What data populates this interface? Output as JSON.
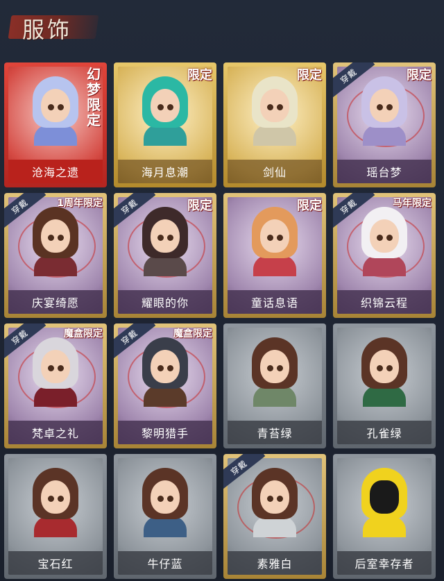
{
  "header": {
    "title": "服饰"
  },
  "cards": [
    {
      "name": "沧海之遗",
      "style": "red",
      "tag": "幻梦限定",
      "tag_vertical": true,
      "wearing": false,
      "hair": "#b7c4ef",
      "outfit": "#7d8fd8"
    },
    {
      "name": "海月息潮",
      "style": "gold",
      "tag": "限定",
      "wearing": false,
      "hair": "#2bb8a4",
      "outfit": "#2f9f9a"
    },
    {
      "name": "剑仙",
      "style": "gold",
      "tag": "限定",
      "wearing": false,
      "hair": "#e9e4c8",
      "outfit": "#cfc6a8"
    },
    {
      "name": "瑶台梦",
      "style": "purple",
      "tag": "限定",
      "wearing": true,
      "wear_label": "穿戴",
      "hair": "#c9c1e6",
      "outfit": "#9d8fc8"
    },
    {
      "name": "庆宴绮愿",
      "style": "purple",
      "tag": "1周年限定",
      "wearing": true,
      "wear_label": "穿戴",
      "hair": "#5a3323",
      "outfit": "#7a2c32"
    },
    {
      "name": "耀眼的你",
      "style": "purple",
      "tag": "限定",
      "wearing": true,
      "wear_label": "穿戴",
      "hair": "#3e2a2a",
      "outfit": "#5a4a4a"
    },
    {
      "name": "童话息语",
      "style": "purple",
      "tag": "限定",
      "wearing": false,
      "hair": "#e39a5c",
      "outfit": "#c6404a"
    },
    {
      "name": "织锦云程",
      "style": "purple",
      "tag": "马年限定",
      "wearing": true,
      "wear_label": "穿戴",
      "hair": "#f2f0f3",
      "outfit": "#b0465a"
    },
    {
      "name": "梵卓之礼",
      "style": "purple",
      "tag": "魔盒限定",
      "wearing": true,
      "wear_label": "穿戴",
      "hair": "#d9d6dc",
      "outfit": "#7a1f2a"
    },
    {
      "name": "黎明猎手",
      "style": "purple",
      "tag": "魔盒限定",
      "wearing": true,
      "wear_label": "穿戴",
      "hair": "#3a3e4a",
      "outfit": "#5b3b2a"
    },
    {
      "name": "青苔绿",
      "style": "gray",
      "tag": "",
      "wearing": false,
      "hair": "#5b3426",
      "outfit": "#6f8768"
    },
    {
      "name": "孔雀绿",
      "style": "gray",
      "tag": "",
      "wearing": false,
      "hair": "#5b3426",
      "outfit": "#2f6a44"
    },
    {
      "name": "宝石红",
      "style": "gray",
      "tag": "",
      "wearing": false,
      "hair": "#5b3426",
      "outfit": "#a82b2f"
    },
    {
      "name": "牛仔蓝",
      "style": "gray",
      "tag": "",
      "wearing": false,
      "hair": "#5b3426",
      "outfit": "#3d5f86"
    },
    {
      "name": "素雅白",
      "style": "gray",
      "tag": "",
      "wearing": true,
      "wear_label": "穿戴",
      "selected": true,
      "hair": "#5b3426",
      "outfit": "#cfd3d6"
    },
    {
      "name": "后室幸存者",
      "style": "gray",
      "tag": "",
      "wearing": false,
      "mask": true,
      "hair": "#f0d21e",
      "outfit": "#f0d21e"
    }
  ]
}
